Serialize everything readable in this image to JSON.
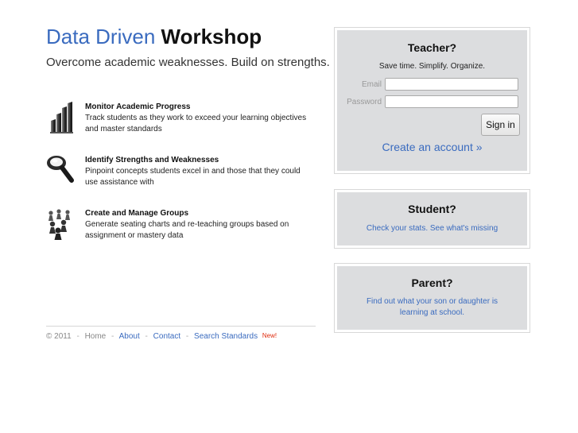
{
  "header": {
    "brand_light": "Data Driven",
    "brand_bold": "Workshop",
    "tagline": "Overcome academic weaknesses. Build on strengths."
  },
  "features": [
    {
      "icon": "bar-chart-icon",
      "title": "Monitor Academic Progress",
      "description": "Track students as they work to exceed your learning objectives and master standards"
    },
    {
      "icon": "magnifier-icon",
      "title": "Identify Strengths and Weaknesses",
      "description": "Pinpoint concepts students excel in and those that they could use assistance with"
    },
    {
      "icon": "group-pawns-icon",
      "title": "Create and Manage Groups",
      "description": "Generate seating charts and re-teaching groups based on assignment or mastery data"
    }
  ],
  "teacher": {
    "title": "Teacher?",
    "subtitle": "Save time. Simplify. Organize.",
    "email_label": "Email",
    "email_value": "",
    "password_label": "Password",
    "password_value": "",
    "signin_label": "Sign in",
    "create_account": "Create an account »"
  },
  "student": {
    "title": "Student?",
    "link": "Check your stats. See what's missing"
  },
  "parent": {
    "title": "Parent?",
    "link_line1": "Find out what your son or daughter is",
    "link_line2": "learning at school."
  },
  "footer": {
    "copyright": "© 2011",
    "sep": "-",
    "home": "Home",
    "about": "About",
    "contact": "Contact",
    "search": "Search Standards",
    "new_badge": "New!"
  },
  "colors": {
    "accent": "#3a6bbf",
    "panel_bg": "#dcdddf",
    "new_badge": "#e02b0d"
  }
}
